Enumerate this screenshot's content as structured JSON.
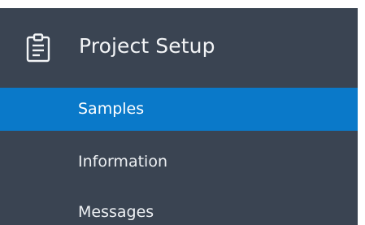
{
  "section": {
    "title": "Project Setup",
    "icon": "clipboard-icon"
  },
  "nav": {
    "items": [
      {
        "label": "Samples",
        "active": true
      },
      {
        "label": "Information",
        "active": false
      },
      {
        "label": "Messages",
        "active": false
      }
    ]
  },
  "colors": {
    "panel_background": "#3a4452",
    "active_background": "#0a79c9",
    "text": "#eef1f4"
  }
}
